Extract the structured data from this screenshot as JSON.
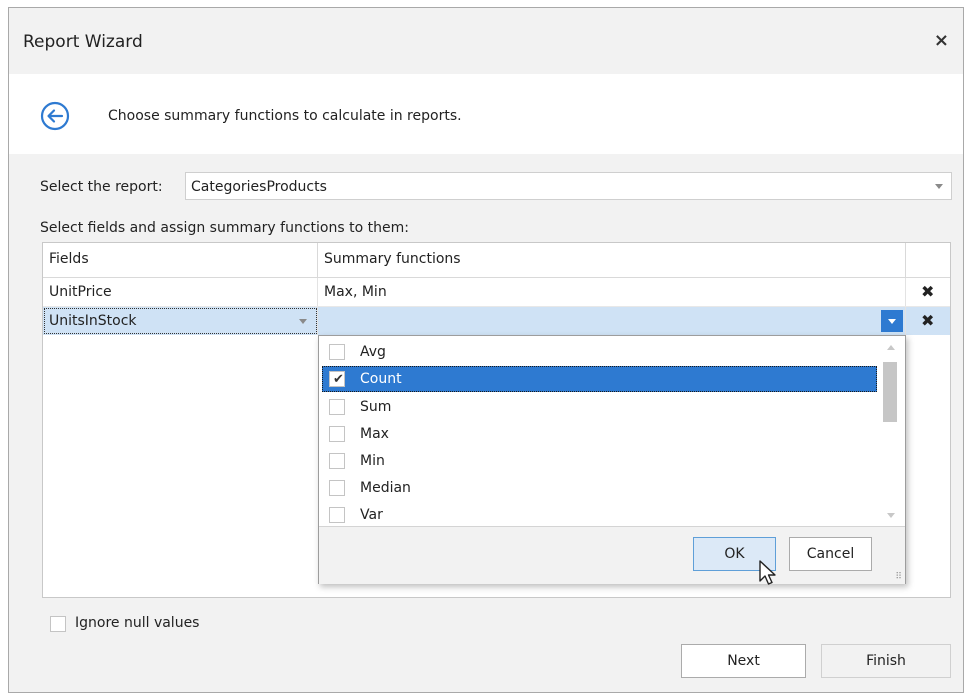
{
  "window": {
    "title": "Report Wizard",
    "close_label": "×"
  },
  "header": {
    "text": "Choose summary functions to calculate in reports."
  },
  "report_select": {
    "label": "Select the report:",
    "value": "CategoriesProducts"
  },
  "fields_label": "Select fields and assign summary functions to them:",
  "grid": {
    "columns": [
      "Fields",
      "Summary functions"
    ],
    "rows": [
      {
        "field": "UnitPrice",
        "functions": "Max, Min"
      },
      {
        "field": "UnitsInStock",
        "functions": ""
      }
    ],
    "delete_glyph": "✖"
  },
  "dropdown": {
    "items": [
      {
        "label": "Avg",
        "checked": false
      },
      {
        "label": "Count",
        "checked": true
      },
      {
        "label": "Sum",
        "checked": false
      },
      {
        "label": "Max",
        "checked": false
      },
      {
        "label": "Min",
        "checked": false
      },
      {
        "label": "Median",
        "checked": false
      },
      {
        "label": "Var",
        "checked": false
      }
    ],
    "ok_label": "OK",
    "cancel_label": "Cancel"
  },
  "ignore_nulls": {
    "label": "Ignore null values",
    "checked": false
  },
  "footer": {
    "next_label": "Next",
    "finish_label": "Finish"
  },
  "colors": {
    "accent": "#2e7ad1",
    "row_selected": "#cfe2f5",
    "panel_bg": "#f2f2f2"
  }
}
